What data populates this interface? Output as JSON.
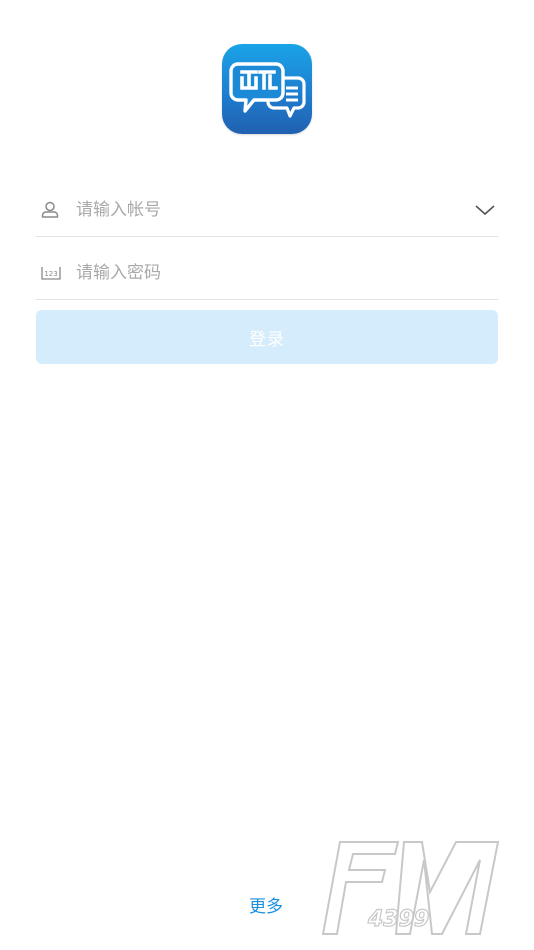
{
  "app": {
    "logo_icon": "chat-bubbles-logo-icon",
    "brand_color": "#1e7ecf"
  },
  "login_form": {
    "account_placeholder": "请输入帐号",
    "password_placeholder": "请输入密码",
    "account_icon": "user-icon",
    "password_icon": "keypad-123-icon",
    "dropdown_icon": "chevron-down-icon",
    "login_label": "登录",
    "login_button_color": "#d4ecfb"
  },
  "footer": {
    "more_label": "更多",
    "more_color": "#1b8fe0"
  },
  "watermark": {
    "text": "FM",
    "subtext": "4399"
  }
}
